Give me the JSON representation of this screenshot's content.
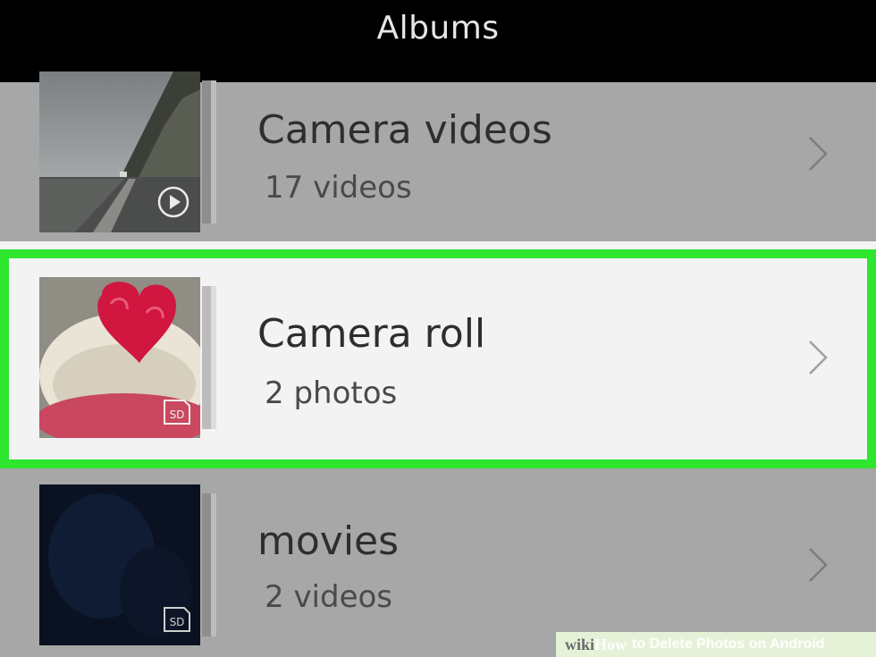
{
  "header": {
    "title": "Albums"
  },
  "albums": [
    {
      "name": "Camera videos",
      "count": "17 videos",
      "badge_icon": "play-icon"
    },
    {
      "name": "Camera roll",
      "count": "2 photos",
      "badge_icon": "sd-card-icon",
      "badge_text": "SD",
      "highlighted": true
    },
    {
      "name": "movies",
      "count": "2 videos",
      "badge_icon": "sd-card-icon",
      "badge_text": "SD"
    }
  ],
  "watermark": {
    "brand_prefix": "wiki",
    "brand_suffix": "How",
    "text": "to Delete Photos on Android"
  },
  "colors": {
    "highlight": "#2ee62e",
    "header_bg": "#000000",
    "list_bg": "#a7a7a7",
    "selected_bg": "#f3f3f3"
  }
}
